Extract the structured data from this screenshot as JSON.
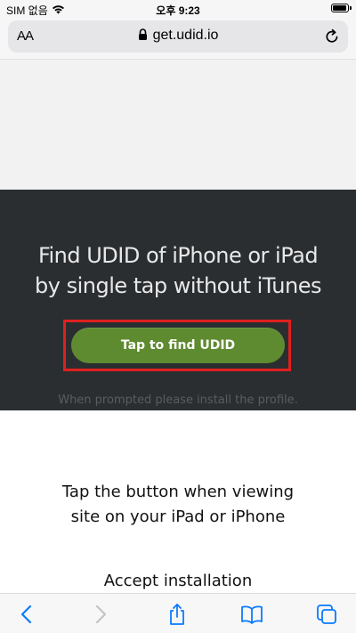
{
  "status_bar": {
    "carrier": "SIM 없음",
    "time": "오후 9:23"
  },
  "address_bar": {
    "text_size_label": "AA",
    "url": "get.udid.io"
  },
  "hero": {
    "title_line1": "Find UDID of iPhone or iPad",
    "title_line2": "by single tap without iTunes",
    "cta_label": "Tap to find UDID",
    "hint": "When prompted please install the profile."
  },
  "steps": {
    "step1_line1": "Tap the button when viewing",
    "step1_line2": "site on your iPad or iPhone",
    "step2_line1": "Accept installation"
  },
  "toolbar": {
    "back": "back-icon",
    "forward": "forward-icon",
    "share": "share-icon",
    "bookmarks": "bookmarks-icon",
    "tabs": "tabs-icon"
  },
  "colors": {
    "hero_bg": "#2b2e31",
    "cta": "#5e8a30",
    "highlight": "#e0201e",
    "ios_blue": "#0a7aff"
  }
}
